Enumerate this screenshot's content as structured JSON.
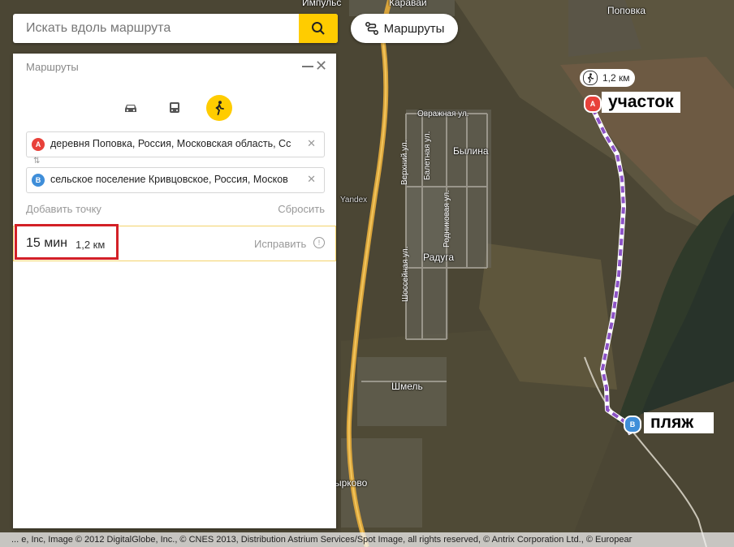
{
  "search": {
    "placeholder": "Искать вдоль маршрута"
  },
  "routes_button": {
    "label": "Маршруты"
  },
  "panel": {
    "title": "Маршруты",
    "point_a": {
      "letter": "A",
      "text": "деревня Поповка, Россия, Московская область, Сс"
    },
    "point_b": {
      "letter": "B",
      "text": "сельское поселение Кривцовское, Россия, Москов"
    },
    "add_point": "Добавить точку",
    "reset": "Сбросить",
    "route": {
      "time": "15 мин",
      "distance": "1,2 км",
      "fix": "Исправить",
      "fix_icon": "!"
    }
  },
  "map": {
    "place_labels": {
      "popovka": "Поповка",
      "karavai": "Каравай",
      "impuls": "Импульс",
      "ovrazhnaya": "Овражная ул.",
      "bylina": "Былина",
      "raduga": "Радуга",
      "shmel": "Шмель",
      "yandex": "Yandex",
      "arkovo": "ырково",
      "verkhniy": "Верхний ул.",
      "baletnaya": "Балетная ул.",
      "rodnikovaya": "Родниковая ул.",
      "shosseynaya": "Шоссейная ул."
    },
    "distance_chip": "1,2 км",
    "marker_a": {
      "letter": "A",
      "tag": "участок"
    },
    "marker_b": {
      "letter": "B",
      "tag": "пляж"
    }
  },
  "attribution": "... e, Inc, Image © 2012 DigitalGlobe, Inc., © CNES 2013, Distribution Astrium Services/Spot Image, all rights reserved, © Antrix Corporation Ltd., © Europeaг",
  "colors": {
    "accent": "#ffcc00",
    "pin_a": "#e8413a",
    "pin_b": "#3f8ed9",
    "route": "#8d53c6",
    "highlight": "#d32027"
  }
}
